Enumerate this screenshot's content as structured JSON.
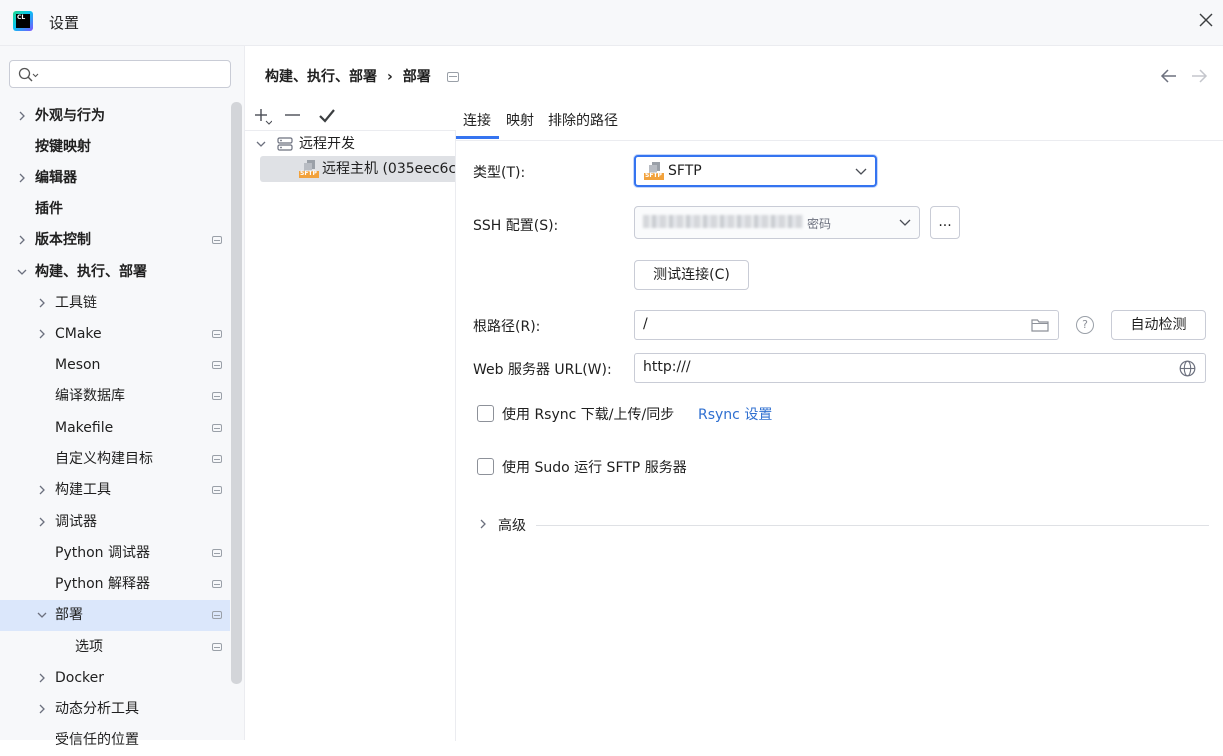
{
  "window": {
    "title": "设置",
    "app_icon_text": "CL"
  },
  "sidebar": {
    "search_placeholder": "",
    "items": [
      {
        "label": "外观与行为"
      },
      {
        "label": "按键映射"
      },
      {
        "label": "编辑器"
      },
      {
        "label": "插件"
      },
      {
        "label": "版本控制"
      },
      {
        "label": "构建、执行、部署"
      },
      {
        "label": "工具链"
      },
      {
        "label": "CMake"
      },
      {
        "label": "Meson"
      },
      {
        "label": "编译数据库"
      },
      {
        "label": "Makefile"
      },
      {
        "label": "自定义构建目标"
      },
      {
        "label": "构建工具"
      },
      {
        "label": "调试器"
      },
      {
        "label": "Python 调试器"
      },
      {
        "label": "Python 解释器"
      },
      {
        "label": "部署"
      },
      {
        "label": "选项"
      },
      {
        "label": "Docker"
      },
      {
        "label": "动态分析工具"
      },
      {
        "label": "受信任的位置"
      }
    ]
  },
  "breadcrumb": {
    "parent": "构建、执行、部署",
    "separator": "›",
    "current": "部署"
  },
  "servers": {
    "group": "远程开发",
    "selected": "远程主机 (035eec6c"
  },
  "tabs": [
    "连接",
    "映射",
    "排除的路径"
  ],
  "form": {
    "type_label": "类型(T):",
    "type_value": "SFTP",
    "ssh_label": "SSH 配置(S):",
    "ssh_suffix": "密码",
    "ellipsis": "...",
    "test_button": "测试连接(C)",
    "root_label": "根路径(R):",
    "root_value": "/",
    "autodetect_button": "自动检测",
    "help_glyph": "?",
    "web_label": "Web 服务器 URL(W):",
    "web_value": "http:///",
    "rsync_label": "使用 Rsync 下载/上传/同步",
    "rsync_link": "Rsync 设置",
    "sudo_label": "使用 Sudo 运行 SFTP 服务器",
    "advanced_label": "高级",
    "sftp_icon_text": "SFTP"
  }
}
